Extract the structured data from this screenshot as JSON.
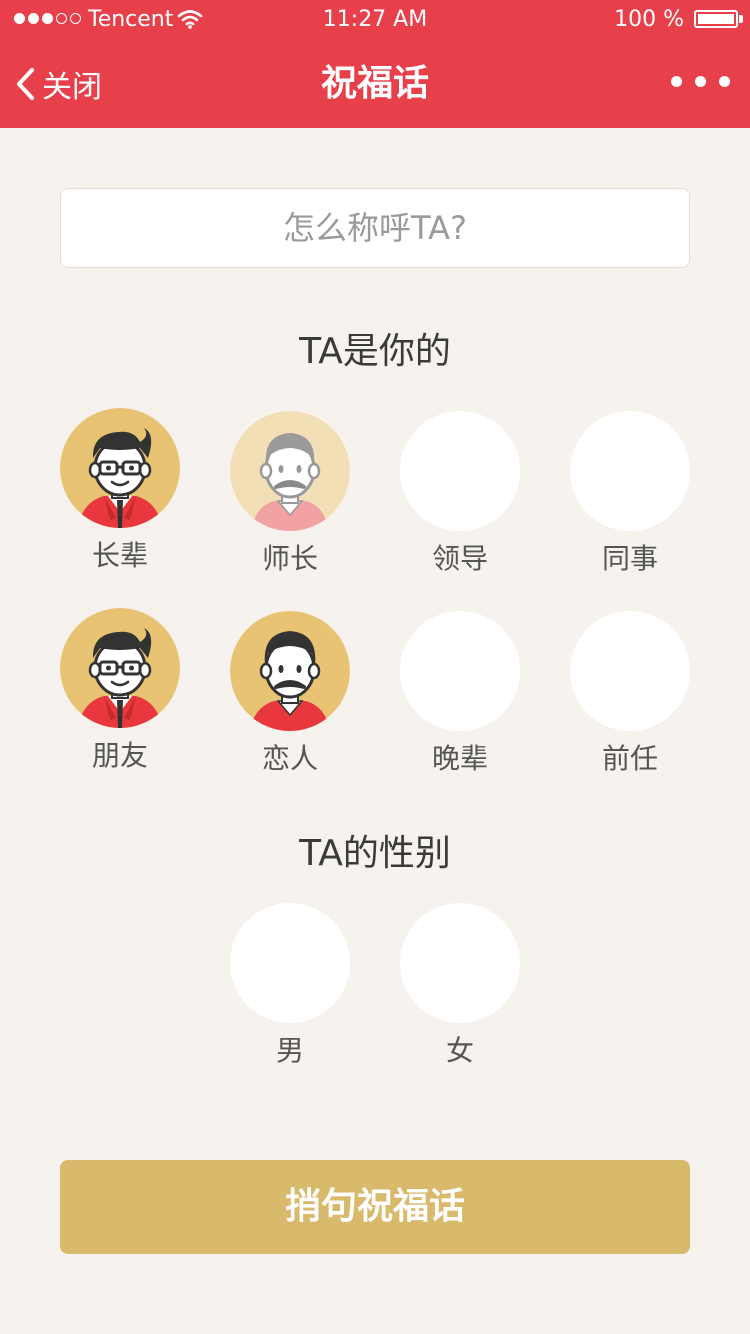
{
  "status_bar": {
    "carrier": "Tencent",
    "time": "11:27 AM",
    "battery": "100 %",
    "signal_icon": "signal-dots-icon",
    "wifi_icon": "wifi-icon",
    "battery_icon": "battery-icon"
  },
  "nav": {
    "back_label": "关闭",
    "title": "祝福话",
    "more_icon": "ellipsis-icon"
  },
  "name_input": {
    "placeholder": "怎么称呼TA?",
    "value": ""
  },
  "relation_section": {
    "title": "TA是你的",
    "options": [
      {
        "label": "长辈",
        "avatar": "glasses-man-avatar",
        "state": "active"
      },
      {
        "label": "师长",
        "avatar": "mustache-gray-man-avatar",
        "state": "faded"
      },
      {
        "label": "领导",
        "avatar": "blank",
        "state": "empty"
      },
      {
        "label": "同事",
        "avatar": "blank",
        "state": "empty"
      },
      {
        "label": "朋友",
        "avatar": "glasses-man-avatar",
        "state": "active"
      },
      {
        "label": "恋人",
        "avatar": "mustache-man-avatar",
        "state": "active"
      },
      {
        "label": "晚辈",
        "avatar": "blank",
        "state": "empty"
      },
      {
        "label": "前任",
        "avatar": "blank",
        "state": "empty"
      }
    ]
  },
  "gender_section": {
    "title": "TA的性别",
    "options": [
      {
        "label": "男"
      },
      {
        "label": "女"
      }
    ]
  },
  "submit_label": "捎句祝福话",
  "colors": {
    "header": "#E8404B",
    "background": "#F6F3EE",
    "accent_gold": "#D9B96B",
    "avatar_bg": "#E8C373",
    "jacket_red": "#E8383D"
  }
}
